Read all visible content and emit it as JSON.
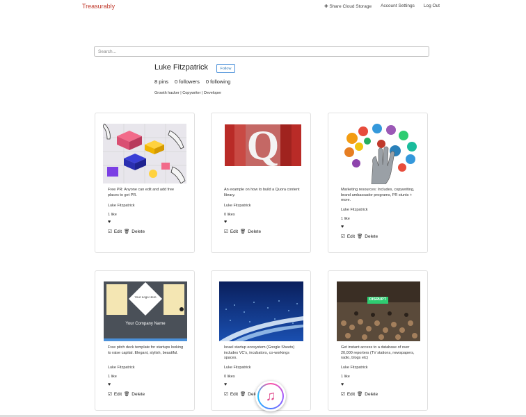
{
  "nav": {
    "brand": "Treasurably",
    "links": [
      "✚ Share Cloud Storage",
      "Account Settings",
      "Log Out"
    ]
  },
  "search": {
    "placeholder": "Search..."
  },
  "profile": {
    "name": "Luke Fitzpatrick",
    "follow_label": "Follow",
    "pins": "8 pins",
    "followers": "0 followers",
    "following": "0 following",
    "bio": "Growth hacker | Copywriter | Developer"
  },
  "cards": [
    {
      "desc": "Free PR: Anyone can edit and add free places to get PR.",
      "author": "Luke Fitzpatrick",
      "likes": "1 like"
    },
    {
      "desc": "An example on how to build a Quora content library.",
      "author": "Luke Fitzpatrick",
      "likes": "0 likes",
      "thumb_letter": "Q"
    },
    {
      "desc": "Marketing resources: Includes, copywriting, brand ambassador programs, PR stunts + more.",
      "author": "Luke Fitzpatrick",
      "likes": "1 like"
    },
    {
      "desc": "Free pitch deck template for startups looking to raise capital. Elegant, stylish, beautiful.",
      "author": "Luke Fitzpatrick",
      "likes": "1 like",
      "thumb_logo": "Your Logo Here",
      "thumb_company": "Your Company Name"
    },
    {
      "desc": "Israel startup ecosystem (Google Sheets) includes VC's, incubators, co-workings spaces.",
      "author": "Luke Fitzpatrick",
      "likes": "0 likes"
    },
    {
      "desc": "Get instant access to a database of over 20,000 reporters (TV stations, newspapers, radio, blogs etc)",
      "author": "Luke Fitzpatrick",
      "likes": "1 like",
      "thumb_banner": "DISRUPT"
    }
  ],
  "actions": {
    "edit": "Edit",
    "delete": "Delete"
  },
  "icons": {
    "heart": "heart-icon",
    "edit": "edit-icon",
    "trash": "trash-icon",
    "dock_app": "itunes-icon"
  },
  "colors": {
    "brand": "#c0392b",
    "follow": "#337ab7",
    "quora": "#b92b27"
  }
}
